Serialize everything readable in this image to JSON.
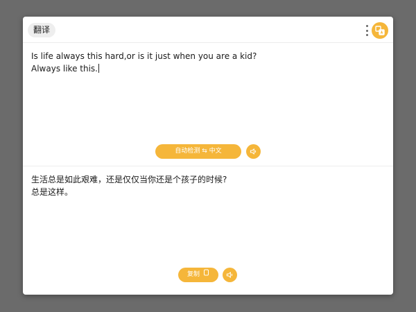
{
  "header": {
    "title": "翻译",
    "menu_icon": "more-vertical-icon",
    "app_icon": "translate-app-icon"
  },
  "source": {
    "lines": [
      "Is life always this hard,or is it just when you are a kid?",
      "Always like this."
    ]
  },
  "language_selector": {
    "label": "自动检测 ⇆ 中文"
  },
  "target": {
    "lines": [
      "生活总是如此艰难，还是仅仅当你还是个孩子的时候?",
      "总是这样。"
    ]
  },
  "copy_button": {
    "label": "复制",
    "icon": "copy-icon"
  },
  "speaker_icon": "speaker-icon",
  "colors": {
    "accent": "#f5b63a",
    "background": "#6b6b6b",
    "panel": "#ffffff"
  }
}
